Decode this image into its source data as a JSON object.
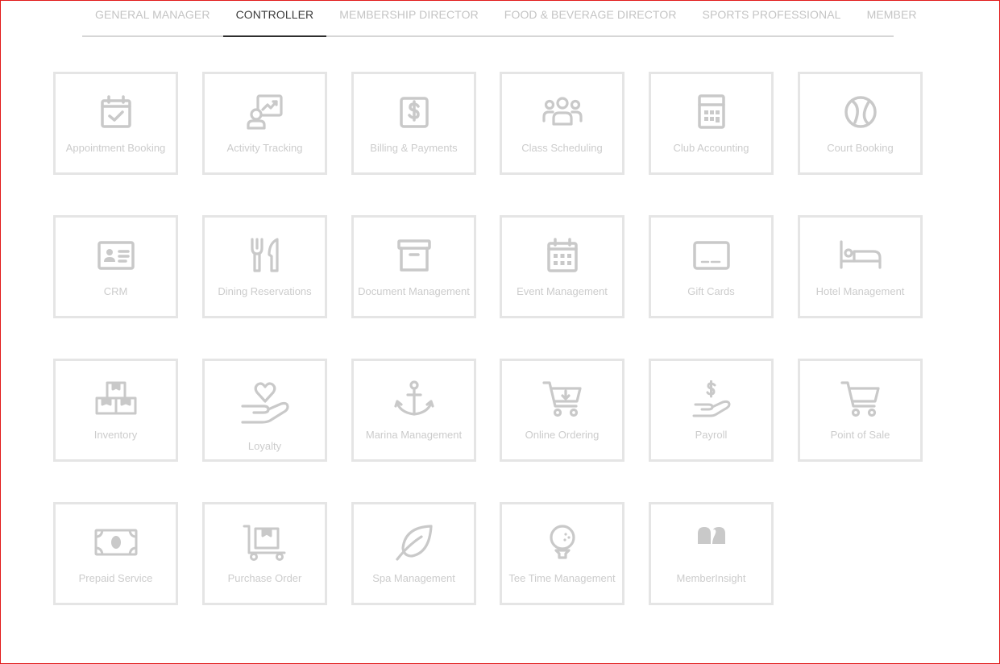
{
  "tabs": [
    {
      "label": "GENERAL MANAGER",
      "active": false
    },
    {
      "label": "CONTROLLER",
      "active": true
    },
    {
      "label": "MEMBERSHIP DIRECTOR",
      "active": false
    },
    {
      "label": "FOOD & BEVERAGE DIRECTOR",
      "active": false
    },
    {
      "label": "SPORTS PROFESSIONAL",
      "active": false
    },
    {
      "label": "MEMBER",
      "active": false
    }
  ],
  "tiles": [
    {
      "label": "Appointment Booking",
      "icon": "calendar-check-icon"
    },
    {
      "label": "Activity Tracking",
      "icon": "activity-chart-icon"
    },
    {
      "label": "Billing & Payments",
      "icon": "dollar-document-icon"
    },
    {
      "label": "Class Scheduling",
      "icon": "group-icon"
    },
    {
      "label": "Club Accounting",
      "icon": "calculator-icon"
    },
    {
      "label": "Court Booking",
      "icon": "tennis-ball-icon"
    },
    {
      "label": "CRM",
      "icon": "id-card-icon"
    },
    {
      "label": "Dining Reservations",
      "icon": "fork-knife-icon"
    },
    {
      "label": "Document Management",
      "icon": "archive-box-icon"
    },
    {
      "label": "Event Management",
      "icon": "calendar-grid-icon"
    },
    {
      "label": "Gift Cards",
      "icon": "gift-card-icon"
    },
    {
      "label": "Hotel Management",
      "icon": "bed-icon"
    },
    {
      "label": "Inventory",
      "icon": "boxes-icon"
    },
    {
      "label": "Loyalty",
      "icon": "heart-hand-icon"
    },
    {
      "label": "Marina Management",
      "icon": "anchor-icon"
    },
    {
      "label": "Online Ordering",
      "icon": "cart-download-icon"
    },
    {
      "label": "Payroll",
      "icon": "money-hand-icon"
    },
    {
      "label": "Point of Sale",
      "icon": "cart-icon"
    },
    {
      "label": "Prepaid Service",
      "icon": "banknote-icon"
    },
    {
      "label": "Purchase Order",
      "icon": "hand-truck-icon"
    },
    {
      "label": "Spa Management",
      "icon": "leaf-icon"
    },
    {
      "label": "Tee Time Management",
      "icon": "golf-ball-icon"
    },
    {
      "label": "MemberInsight",
      "icon": "memberinsight-logo-icon"
    }
  ],
  "colors": {
    "tile_border": "#e5e5e5",
    "icon": "#c9c9c9",
    "label": "#cccccc",
    "tab_inactive": "#c4c4c4",
    "tab_active": "#3b3b3b",
    "frame": "#e21b1b"
  }
}
